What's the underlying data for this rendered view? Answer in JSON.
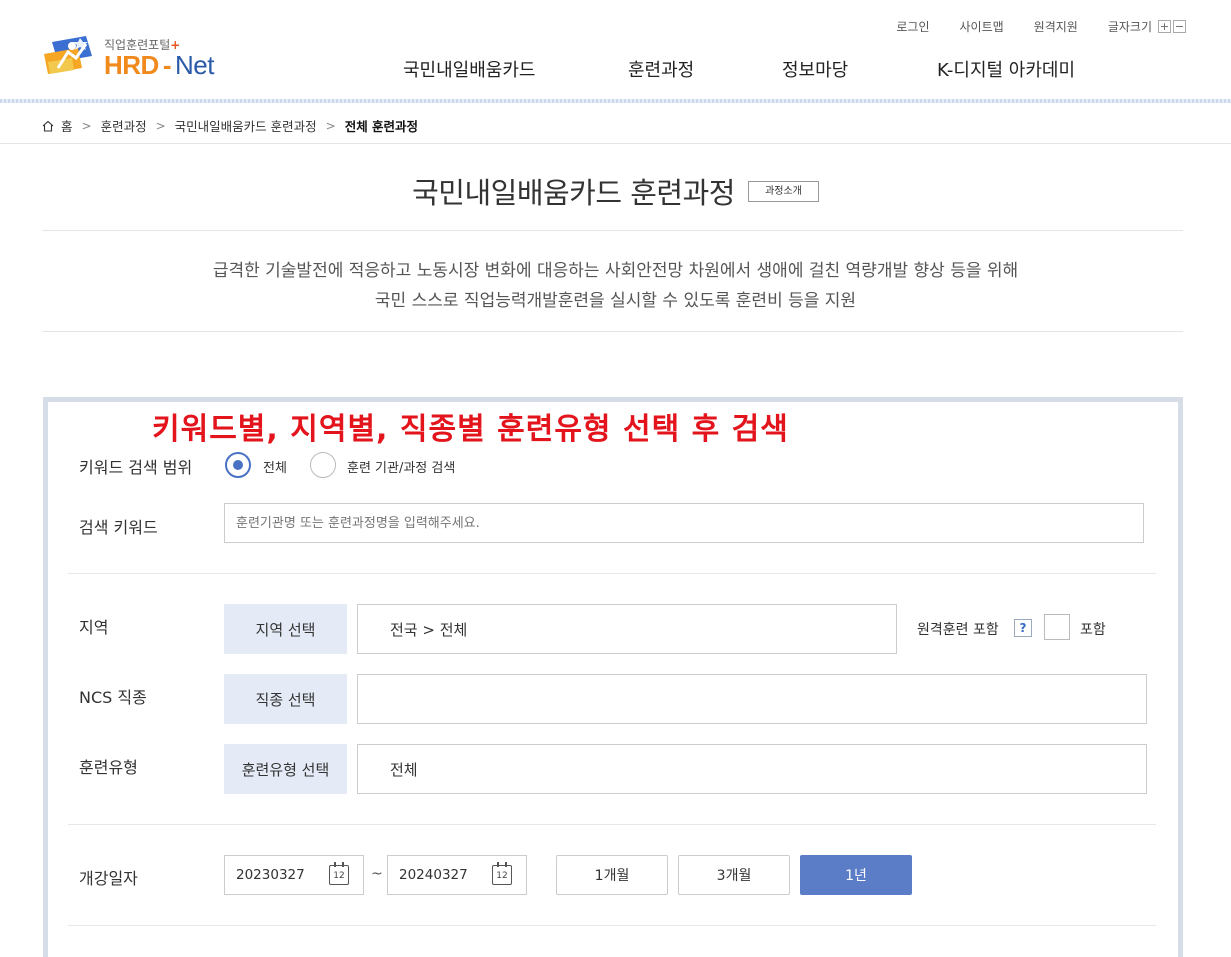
{
  "header": {
    "util_links": [
      "로그인",
      "사이트맵",
      "원격지원"
    ],
    "font_size_label": "글자크기",
    "font_plus": "+",
    "font_minus": "−",
    "logo_sub": "직업훈련포털",
    "logo_plus": "+",
    "logo_hrd": "HRD",
    "logo_dash": "-",
    "logo_net": "Net",
    "nav": [
      "국민내일배움카드",
      "훈련과정",
      "정보마당",
      "K-디지털 아카데미"
    ]
  },
  "breadcrumb": {
    "home_icon": "home-icon",
    "home": "홈",
    "items": [
      "훈련과정",
      "국민내일배움카드 훈련과정",
      "전체 훈련과정"
    ],
    "separator": ">"
  },
  "page": {
    "title": "국민내일배움카드 훈련과정",
    "intro_button": "과정소개",
    "description_line1": "급격한 기술발전에 적응하고 노동시장 변화에 대응하는 사회안전망 차원에서 생애에 걸친 역량개발 향상 등을 위해",
    "description_line2": "국민 스스로 직업능력개발훈련을 실시할 수 있도록 훈련비 등을 지원"
  },
  "overlay_caption": "키워드별, 지역별, 직종별 훈련유형 선택 후 검색",
  "search": {
    "scope_label": "키워드 검색 범위",
    "scope_options": [
      "전체",
      "훈련 기관/과정 검색"
    ],
    "scope_selected": "전체",
    "keyword_label": "검색 키워드",
    "keyword_placeholder": "훈련기관명 또는 훈련과정명을 입력해주세요.",
    "keyword_value": "",
    "region_label": "지역",
    "region_button": "지역 선택",
    "region_value": "전국 > 전체",
    "remote_label": "원격훈련 포함",
    "remote_help": "?",
    "remote_checkbox_label": "포함",
    "remote_checked": false,
    "ncs_label": "NCS 직종",
    "ncs_button": "직종 선택",
    "ncs_value": "",
    "type_label": "훈련유형",
    "type_button": "훈련유형 선택",
    "type_value": "전체",
    "date_label": "개강일자",
    "date_from": "20230327",
    "date_to": "20240327",
    "date_separator": "~",
    "calendar_icon_text": "12",
    "periods": [
      "1개월",
      "3개월",
      "1년"
    ],
    "active_period": "1년"
  },
  "colors": {
    "accent": "#5b7cc6",
    "select_bg": "#e4ebf6",
    "caption_red": "#e3141c",
    "logo_orange": "#f08a1c",
    "logo_blue": "#2a5aa8"
  }
}
